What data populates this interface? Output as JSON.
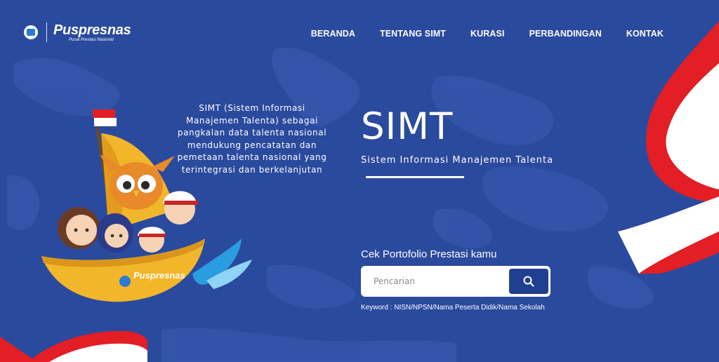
{
  "logo": {
    "brand": "Puspresnas",
    "tagline": "Pusat Prestasi Nasional",
    "emblem_icon": "tut-wuri-handayani-emblem-icon"
  },
  "nav": {
    "items": [
      {
        "label": "BERANDA"
      },
      {
        "label": "TENTANG SIMT"
      },
      {
        "label": "KURASI"
      },
      {
        "label": "PERBANDINGAN"
      },
      {
        "label": "KONTAK"
      }
    ]
  },
  "hero": {
    "description": "SIMT (Sistem Informasi Manajemen Talenta) sebagai pangkalan data talenta nasional mendukung pencatatan dan pemetaan talenta nasional yang terintegrasi dan berkelanjutan",
    "title": "SIMT",
    "subtitle": "Sistem Informasi Manajemen Talenta"
  },
  "search": {
    "label": "Cek Portofolio Prestasi kamu",
    "placeholder": "Pencarian",
    "value": "",
    "button_icon": "search-icon",
    "keyword_hint": "Keyword : NISN/NPSN/Nama Peserta Didik/Nama Sekolah"
  },
  "illustration": {
    "boat_label": "Puspresnas"
  },
  "colors": {
    "background": "#2a4a9e",
    "search_button": "#1f3f91",
    "flag_red": "#e31e24",
    "boat_yellow": "#f2b62a"
  }
}
